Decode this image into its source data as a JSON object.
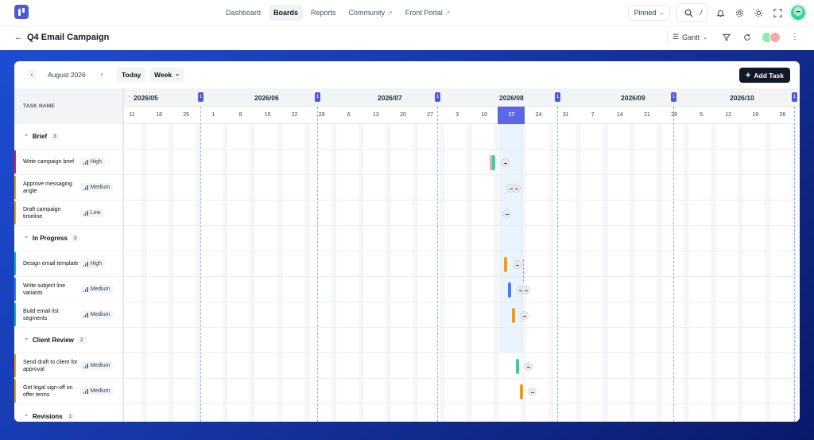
{
  "nav": {
    "links": [
      {
        "label": "Dashboard",
        "active": false,
        "external": false
      },
      {
        "label": "Boards",
        "active": true,
        "external": false
      },
      {
        "label": "Reports",
        "active": false,
        "external": false
      },
      {
        "label": "Community",
        "active": false,
        "external": true
      },
      {
        "label": "Front Portal",
        "active": false,
        "external": true
      }
    ],
    "pinned_label": "Pinned",
    "search_shortcut": "/"
  },
  "header": {
    "title": "Q4 Email Campaign",
    "view_label": "Gantt"
  },
  "toolbar": {
    "month_label": "August 2026",
    "today_label": "Today",
    "scale_label": "Week",
    "add_task_label": "Add Task"
  },
  "sidebar": {
    "column_header": "TASK NAME",
    "groups": [
      {
        "name": "Brief",
        "count": "3",
        "color": "#e11d48",
        "tasks": [
          {
            "name": "Write campaign brief",
            "priority": "High",
            "strip": "#e11d48"
          },
          {
            "name": "Approve messaging angle",
            "priority": "Medium",
            "strip": "#f59e0b"
          },
          {
            "name": "Draft campaign timeline",
            "priority": "Low",
            "strip": "#f59e0b"
          }
        ]
      },
      {
        "name": "In Progress",
        "count": "3",
        "tasks": [
          {
            "name": "Design email template",
            "priority": "High",
            "strip": "#14b8a6"
          },
          {
            "name": "Write subject line variants",
            "priority": "Medium",
            "strip": "#3b82f6"
          },
          {
            "name": "Build email list segments",
            "priority": "Medium",
            "strip": "#14b8a6"
          }
        ]
      },
      {
        "name": "Client Review",
        "count": "2",
        "tasks": [
          {
            "name": "Send draft to client for approval",
            "priority": "Medium",
            "strip": "#f59e0b"
          },
          {
            "name": "Get legal sign-off on offer terms",
            "priority": "Medium",
            "strip": "#f59e0b"
          }
        ]
      },
      {
        "name": "Revisions",
        "count": "1",
        "tasks": []
      }
    ]
  },
  "timeline": {
    "months": [
      {
        "label": "2026/05",
        "tag": "1"
      },
      {
        "label": "2026/06",
        "tag": "1"
      },
      {
        "label": "2026/07",
        "tag": "1"
      },
      {
        "label": "2026/08",
        "tag": "1"
      },
      {
        "label": "2026/09",
        "tag": "1"
      },
      {
        "label": "2026/10",
        "tag": "1"
      }
    ],
    "days": [
      "11",
      "18",
      "25",
      "1",
      "8",
      "15",
      "22",
      "29",
      "6",
      "13",
      "20",
      "27",
      "3",
      "10",
      "17",
      "24",
      "31",
      "7",
      "14",
      "21",
      "28",
      "5",
      "12",
      "19",
      "26"
    ],
    "today_day": "17",
    "bar_colors": {
      "green": "#34d399",
      "amber": "#f59e0b",
      "blue": "#3b82f6",
      "rose": "#fda4af"
    }
  }
}
